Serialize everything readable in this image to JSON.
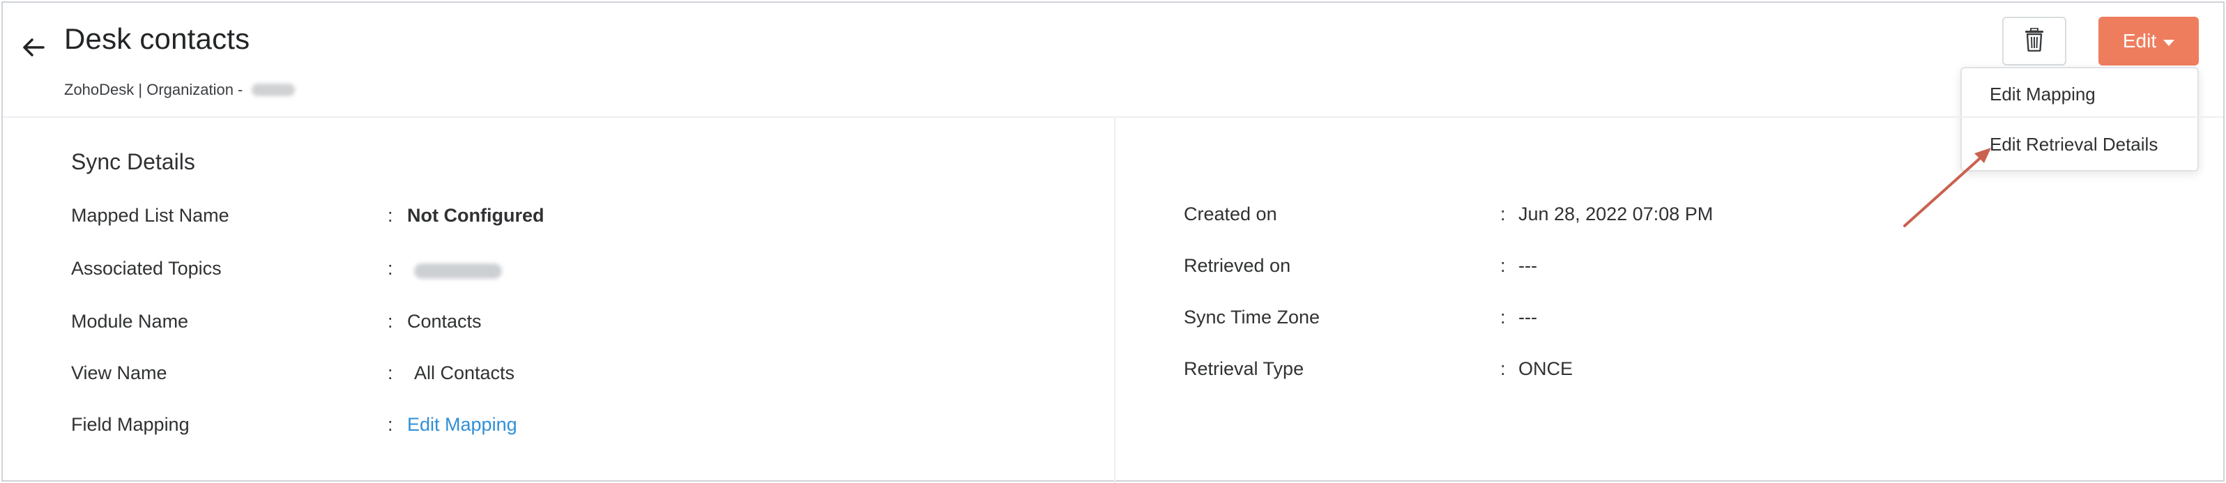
{
  "header": {
    "title": "Desk contacts",
    "subtitle": "ZohoDesk | Organization - ",
    "edit_label": "Edit"
  },
  "dropdown": {
    "items": [
      {
        "label": "Edit Mapping"
      },
      {
        "label": "Edit Retrieval Details"
      }
    ]
  },
  "sync_details": {
    "title": "Sync Details",
    "left": [
      {
        "label": "Mapped List Name",
        "value": "Not Configured"
      },
      {
        "label": "Associated Topics",
        "value": ""
      },
      {
        "label": "Module Name",
        "value": "Contacts"
      },
      {
        "label": "View Name",
        "value": "All Contacts"
      },
      {
        "label": "Field Mapping",
        "value": "Edit Mapping"
      }
    ],
    "right": [
      {
        "label": "Created on",
        "value": "Jun 28, 2022 07:08 PM"
      },
      {
        "label": "Retrieved on",
        "value": "---"
      },
      {
        "label": "Sync Time Zone",
        "value": "---"
      },
      {
        "label": "Retrieval Type",
        "value": "ONCE"
      }
    ]
  },
  "colors": {
    "accent": "#ee7d5e",
    "link": "#2f8fd8",
    "arrow": "#c9624f"
  },
  "icons": {
    "back": "arrow-left-icon",
    "delete": "trash-icon",
    "caret": "caret-down-icon"
  }
}
